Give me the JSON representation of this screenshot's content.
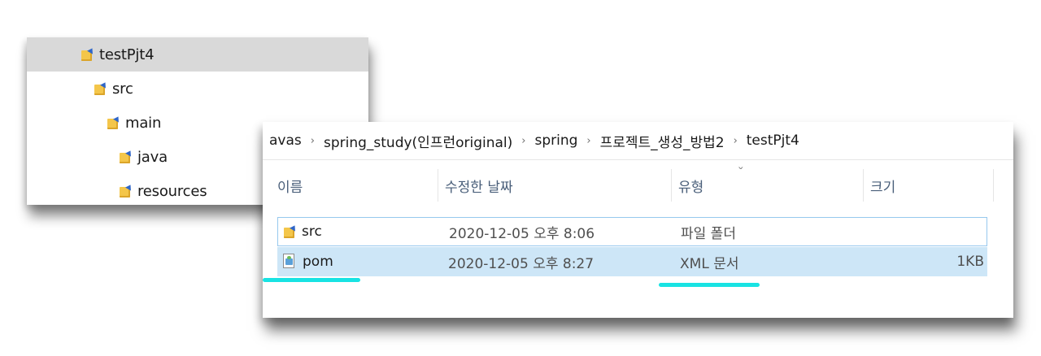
{
  "tree": {
    "items": [
      {
        "label": "testPjt4",
        "selected": true
      },
      {
        "label": "src",
        "selected": false
      },
      {
        "label": "main",
        "selected": false
      },
      {
        "label": "java",
        "selected": false
      },
      {
        "label": "resources",
        "selected": false
      }
    ]
  },
  "explorer": {
    "breadcrumb": [
      "avas",
      "spring_study(인프런original)",
      "spring",
      "프로젝트_생성_방법2",
      "testPjt4"
    ],
    "breadcrumb_separator": "›",
    "columns": {
      "name": "이름",
      "modified": "수정한 날짜",
      "type": "유형",
      "size": "크기"
    },
    "sort_indicator": "˅",
    "rows": [
      {
        "name": "src",
        "modified": "2020-12-05 오후 8:06",
        "type": "파일 폴더",
        "size": "",
        "icon": "folder-icon"
      },
      {
        "name": "pom",
        "modified": "2020-12-05 오후 8:27",
        "type": "XML 문서",
        "size": "1KB",
        "icon": "xml-file-icon"
      }
    ]
  },
  "colors": {
    "selected_tree_row": "#d9d9d9",
    "selected_file_row": "#cde6f7",
    "focus_border": "#96c8ee",
    "annotation_underline": "#18e3e3",
    "folder": "#f4c64a"
  }
}
